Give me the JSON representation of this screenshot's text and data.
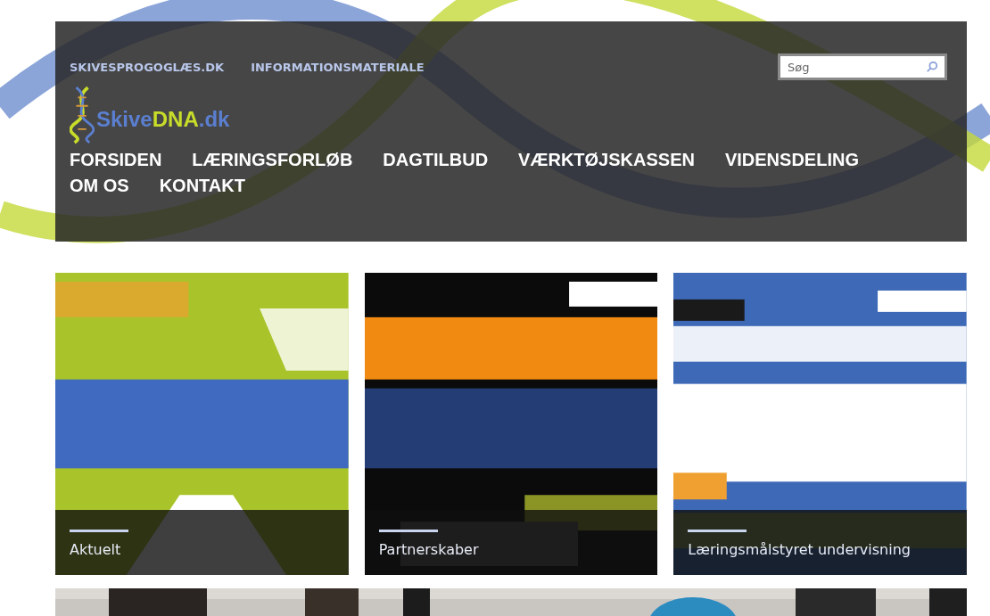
{
  "top_links": [
    {
      "label": "SKIVESPROGOGLÆS.DK"
    },
    {
      "label": "INFORMATIONSMATERIALE"
    }
  ],
  "search": {
    "placeholder": "Søg"
  },
  "logo": {
    "parts": [
      "Skive",
      "DNA",
      ".dk"
    ]
  },
  "nav": [
    {
      "label": "FORSIDEN"
    },
    {
      "label": "LÆRINGSFORLØB"
    },
    {
      "label": "DAGTILBUD"
    },
    {
      "label": "VÆRKTØJSKASSEN"
    },
    {
      "label": "VIDENSDELING"
    },
    {
      "label": "OM OS"
    },
    {
      "label": "KONTAKT"
    }
  ],
  "tiles": [
    {
      "caption": "Aktuelt",
      "color": "#a9c42b"
    },
    {
      "caption": "Partnerskaber",
      "color": "#0b0b0b"
    },
    {
      "caption": "Læringsmålstyret undervisning",
      "color": "#3d69b6"
    }
  ]
}
